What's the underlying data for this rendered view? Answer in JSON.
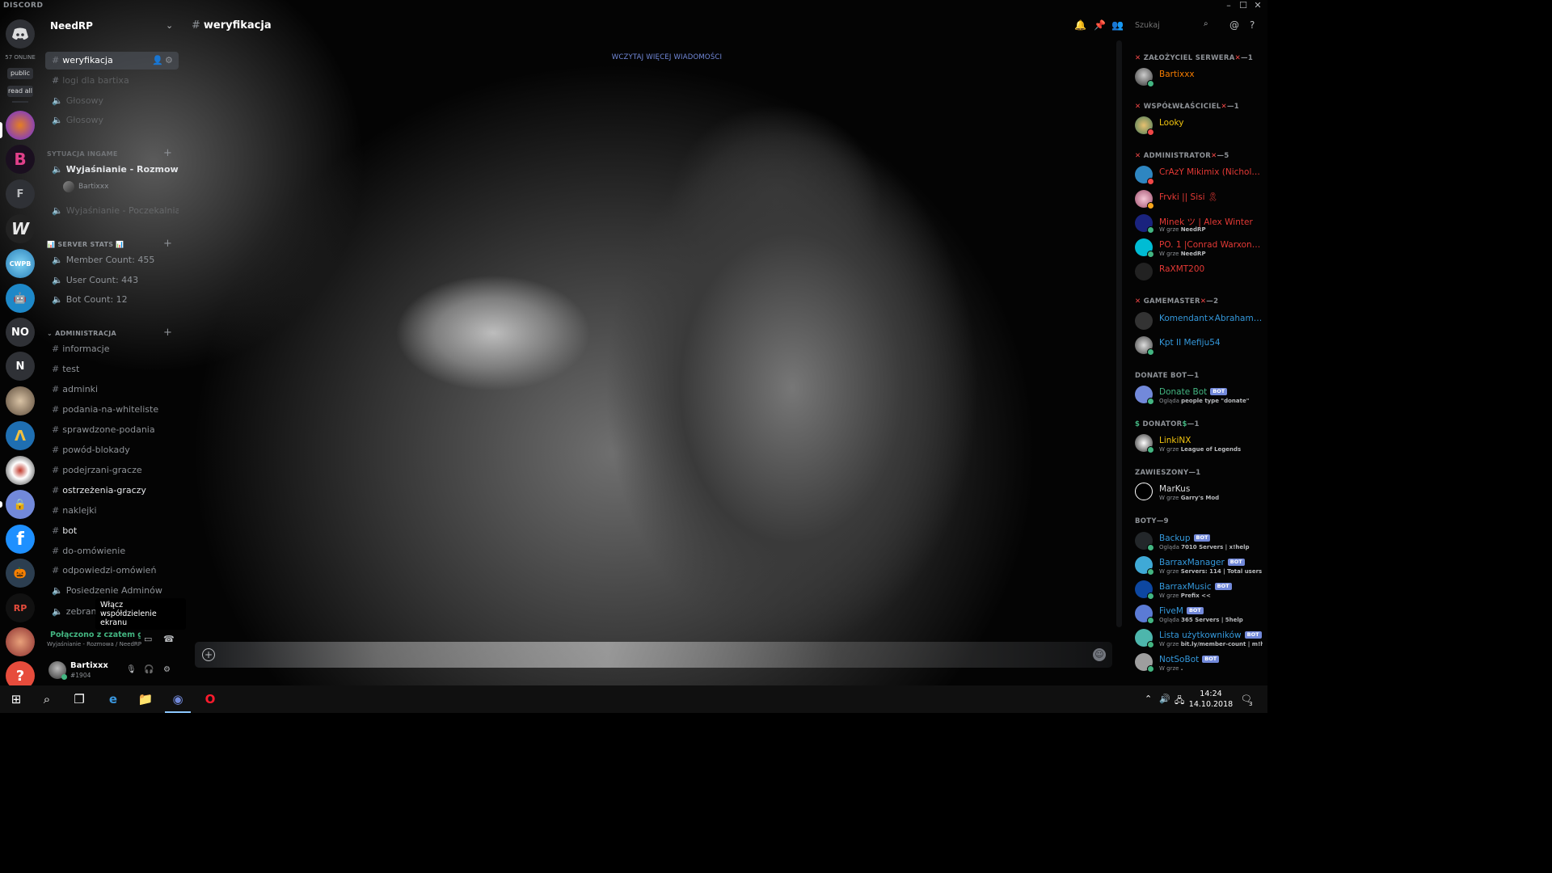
{
  "app": {
    "brand": "DISCORD",
    "window_controls": {
      "minimize": "–",
      "maximize": "☐",
      "close": "✕"
    }
  },
  "guild_bar": {
    "online_count": "57 ONLINE",
    "public_label": "public",
    "read_all_label": "read all",
    "letters": [
      "F",
      "NO",
      "N"
    ]
  },
  "server": {
    "name": "NeedRP"
  },
  "channels": {
    "active": "weryfikacja",
    "top_faded": [
      "logi dla bartixa",
      "Głosowy",
      "Głosowy"
    ],
    "cat_sytuacja": "SYTUACJA INGAME",
    "voice_explain": "Wyjaśnianie - Rozmowa",
    "voice_user": "Bartixxx",
    "voice_waiting": "Wyjaśnianie - Poczekalnia",
    "cat_stats": "SERVER STATS",
    "stats": [
      "Member Count: 455",
      "User Count: 443",
      "Bot Count: 12"
    ],
    "cat_admin": "ADMINISTRACJA",
    "admin": [
      "informacje",
      "test",
      "adminki",
      "podania-na-whiteliste",
      "sprawdzone-podania",
      "powód-blokady",
      "podejrzani-gracze",
      "ostrzeżenia-graczy",
      "naklejki",
      "bot",
      "do-omówienie",
      "odpowiedzi-omówień",
      "Posiedzenie Adminów",
      "zebrani"
    ],
    "tooltip": "Włącz współdzielenie ekranu"
  },
  "voice_connection": {
    "status": "Połączono z czatem głosowym",
    "location": "Wyjaśnianie - Rozmowa / NeedRP"
  },
  "user": {
    "name": "Bartixxx",
    "tag": "#1904"
  },
  "header": {
    "channel": "weryfikacja",
    "search_placeholder": "Szukaj"
  },
  "messages": {
    "load_more": "WCZYTAJ WIĘCEJ WIADOMOŚCI"
  },
  "members": {
    "roles": [
      {
        "name": "ZAŁOŻYCIEL SERWERA",
        "count": "1"
      },
      {
        "name": "WSPÓŁWŁAŚCICIEL",
        "count": "1"
      },
      {
        "name": "ADMINISTRATOR",
        "count": "5"
      },
      {
        "name": "GAMEMASTER",
        "count": "2"
      },
      {
        "name": "DONATE BOT",
        "count": "1"
      },
      {
        "name": "DONATOR",
        "count": "1"
      },
      {
        "name": "ZAWIESZONY",
        "count": "1"
      },
      {
        "name": "BOTY",
        "count": "9"
      }
    ],
    "list": [
      {
        "name": "Bartixxx",
        "sub": "",
        "color": "#f57c00"
      },
      {
        "name": "Looky",
        "sub": "",
        "color": "#f1c40f"
      },
      {
        "name": "CrAzY Mikimix (Nicholas...",
        "sub": "",
        "color": "#e53935"
      },
      {
        "name": "Frvki || Sisi 🎗",
        "sub": "",
        "color": "#e53935"
      },
      {
        "name": "Minek ツ | Alex Winter",
        "sub_prefix": "W grze",
        "sub_bold": "NeedRP",
        "color": "#e53935"
      },
      {
        "name": "PO. 1 |Conrad Warxon|1...",
        "sub_prefix": "W grze",
        "sub_bold": "NeedRP",
        "color": "#e53935"
      },
      {
        "name": "RaXMT200",
        "sub": "",
        "color": "#e53935"
      },
      {
        "name": "Komendant×Abraham L...",
        "sub": "",
        "color": "#3498db"
      },
      {
        "name": "Kpt II Mefiju54",
        "sub": "",
        "color": "#3498db"
      },
      {
        "name": "Donate Bot",
        "sub_prefix": "Ogląda",
        "sub_bold": "people type \"donate\"",
        "color": "#43b581",
        "bot": "BOT"
      },
      {
        "name": "LinkiNX",
        "sub_prefix": "W grze",
        "sub_bold": "League of Legends",
        "color": "#f1c40f"
      },
      {
        "name": "MarKus",
        "sub_prefix": "W grze",
        "sub_bold": "Garry's Mod",
        "color": "#dcddde"
      },
      {
        "name": "Backup",
        "sub_prefix": "Ogląda",
        "sub_bold": "7010 Servers | x!help",
        "color": "#3498db",
        "bot": "BOT"
      },
      {
        "name": "BarraxManager",
        "sub_prefix": "W grze",
        "sub_bold": "Servers: 114 | Total users: 1...",
        "color": "#3498db",
        "bot": "BOT"
      },
      {
        "name": "BarraxMusic",
        "sub_prefix": "W grze",
        "sub_bold": "Prefix <<",
        "color": "#3498db",
        "bot": "BOT"
      },
      {
        "name": "FiveM",
        "sub_prefix": "Ogląda",
        "sub_bold": "365 Servers | 5help",
        "color": "#3498db",
        "bot": "BOT"
      },
      {
        "name": "Lista użytkowników",
        "sub_prefix": "W grze",
        "sub_bold": "bit.ly/member-count | m!h...",
        "color": "#3498db",
        "bot": "BOT"
      },
      {
        "name": "NotSoBot",
        "sub_prefix": "W grze",
        "sub_bold": ".",
        "color": "#3498db",
        "bot": "BOT"
      }
    ]
  },
  "taskbar": {
    "time": "14:24",
    "date": "14.10.2018",
    "notif_count": "3"
  },
  "colors": {
    "online": "#43b581",
    "dnd": "#f04747",
    "idle": "#faa61a",
    "blurple": "#7289da"
  }
}
